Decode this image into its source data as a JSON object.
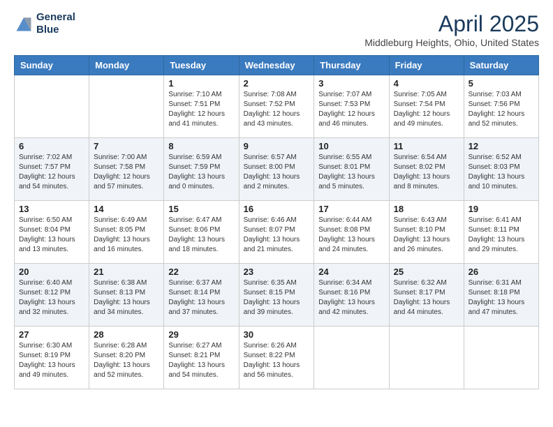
{
  "logo": {
    "line1": "General",
    "line2": "Blue"
  },
  "title": "April 2025",
  "location": "Middleburg Heights, Ohio, United States",
  "days_of_week": [
    "Sunday",
    "Monday",
    "Tuesday",
    "Wednesday",
    "Thursday",
    "Friday",
    "Saturday"
  ],
  "weeks": [
    [
      {
        "day": "",
        "info": ""
      },
      {
        "day": "",
        "info": ""
      },
      {
        "day": "1",
        "info": "Sunrise: 7:10 AM\nSunset: 7:51 PM\nDaylight: 12 hours and 41 minutes."
      },
      {
        "day": "2",
        "info": "Sunrise: 7:08 AM\nSunset: 7:52 PM\nDaylight: 12 hours and 43 minutes."
      },
      {
        "day": "3",
        "info": "Sunrise: 7:07 AM\nSunset: 7:53 PM\nDaylight: 12 hours and 46 minutes."
      },
      {
        "day": "4",
        "info": "Sunrise: 7:05 AM\nSunset: 7:54 PM\nDaylight: 12 hours and 49 minutes."
      },
      {
        "day": "5",
        "info": "Sunrise: 7:03 AM\nSunset: 7:56 PM\nDaylight: 12 hours and 52 minutes."
      }
    ],
    [
      {
        "day": "6",
        "info": "Sunrise: 7:02 AM\nSunset: 7:57 PM\nDaylight: 12 hours and 54 minutes."
      },
      {
        "day": "7",
        "info": "Sunrise: 7:00 AM\nSunset: 7:58 PM\nDaylight: 12 hours and 57 minutes."
      },
      {
        "day": "8",
        "info": "Sunrise: 6:59 AM\nSunset: 7:59 PM\nDaylight: 13 hours and 0 minutes."
      },
      {
        "day": "9",
        "info": "Sunrise: 6:57 AM\nSunset: 8:00 PM\nDaylight: 13 hours and 2 minutes."
      },
      {
        "day": "10",
        "info": "Sunrise: 6:55 AM\nSunset: 8:01 PM\nDaylight: 13 hours and 5 minutes."
      },
      {
        "day": "11",
        "info": "Sunrise: 6:54 AM\nSunset: 8:02 PM\nDaylight: 13 hours and 8 minutes."
      },
      {
        "day": "12",
        "info": "Sunrise: 6:52 AM\nSunset: 8:03 PM\nDaylight: 13 hours and 10 minutes."
      }
    ],
    [
      {
        "day": "13",
        "info": "Sunrise: 6:50 AM\nSunset: 8:04 PM\nDaylight: 13 hours and 13 minutes."
      },
      {
        "day": "14",
        "info": "Sunrise: 6:49 AM\nSunset: 8:05 PM\nDaylight: 13 hours and 16 minutes."
      },
      {
        "day": "15",
        "info": "Sunrise: 6:47 AM\nSunset: 8:06 PM\nDaylight: 13 hours and 18 minutes."
      },
      {
        "day": "16",
        "info": "Sunrise: 6:46 AM\nSunset: 8:07 PM\nDaylight: 13 hours and 21 minutes."
      },
      {
        "day": "17",
        "info": "Sunrise: 6:44 AM\nSunset: 8:08 PM\nDaylight: 13 hours and 24 minutes."
      },
      {
        "day": "18",
        "info": "Sunrise: 6:43 AM\nSunset: 8:10 PM\nDaylight: 13 hours and 26 minutes."
      },
      {
        "day": "19",
        "info": "Sunrise: 6:41 AM\nSunset: 8:11 PM\nDaylight: 13 hours and 29 minutes."
      }
    ],
    [
      {
        "day": "20",
        "info": "Sunrise: 6:40 AM\nSunset: 8:12 PM\nDaylight: 13 hours and 32 minutes."
      },
      {
        "day": "21",
        "info": "Sunrise: 6:38 AM\nSunset: 8:13 PM\nDaylight: 13 hours and 34 minutes."
      },
      {
        "day": "22",
        "info": "Sunrise: 6:37 AM\nSunset: 8:14 PM\nDaylight: 13 hours and 37 minutes."
      },
      {
        "day": "23",
        "info": "Sunrise: 6:35 AM\nSunset: 8:15 PM\nDaylight: 13 hours and 39 minutes."
      },
      {
        "day": "24",
        "info": "Sunrise: 6:34 AM\nSunset: 8:16 PM\nDaylight: 13 hours and 42 minutes."
      },
      {
        "day": "25",
        "info": "Sunrise: 6:32 AM\nSunset: 8:17 PM\nDaylight: 13 hours and 44 minutes."
      },
      {
        "day": "26",
        "info": "Sunrise: 6:31 AM\nSunset: 8:18 PM\nDaylight: 13 hours and 47 minutes."
      }
    ],
    [
      {
        "day": "27",
        "info": "Sunrise: 6:30 AM\nSunset: 8:19 PM\nDaylight: 13 hours and 49 minutes."
      },
      {
        "day": "28",
        "info": "Sunrise: 6:28 AM\nSunset: 8:20 PM\nDaylight: 13 hours and 52 minutes."
      },
      {
        "day": "29",
        "info": "Sunrise: 6:27 AM\nSunset: 8:21 PM\nDaylight: 13 hours and 54 minutes."
      },
      {
        "day": "30",
        "info": "Sunrise: 6:26 AM\nSunset: 8:22 PM\nDaylight: 13 hours and 56 minutes."
      },
      {
        "day": "",
        "info": ""
      },
      {
        "day": "",
        "info": ""
      },
      {
        "day": "",
        "info": ""
      }
    ]
  ]
}
